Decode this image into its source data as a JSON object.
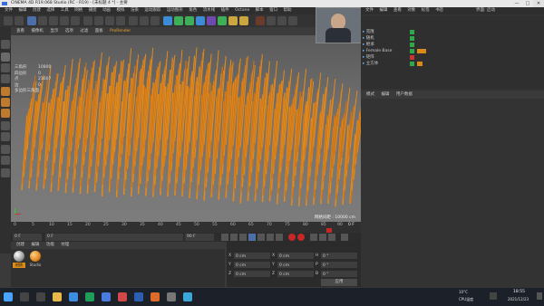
{
  "title_bar": {
    "title": "CINEMA 4D R19.068 Studio (RC - R19) - [未标题 4 *] - 主要",
    "minimize": "—",
    "maximize": "□",
    "close": "✕"
  },
  "main_menu": [
    "文件",
    "编辑",
    "创建",
    "选择",
    "工具",
    "网格",
    "捕捉",
    "动画",
    "模拟",
    "渲染",
    "运动跟踪",
    "运动图形",
    "角色",
    "流水线",
    "插件",
    "Octane",
    "脚本",
    "窗口",
    "帮助"
  ],
  "viewport_menu": [
    "查看",
    "摄像机",
    "显示",
    "选项",
    "过滤",
    "面板",
    "ProRender"
  ],
  "viewport_stats": [
    {
      "label": "三角形",
      "value": "10800"
    },
    {
      "label": "四边形",
      "value": "0"
    },
    {
      "label": "点",
      "value": "21607"
    },
    {
      "label": "边",
      "value": "0"
    },
    {
      "label": "多边形三角面",
      "value": ""
    }
  ],
  "grid_info": "网格间距 : 10000 cm",
  "timeline_ticks": [
    "0",
    "5",
    "10",
    "15",
    "20",
    "25",
    "30",
    "35",
    "40",
    "45",
    "50",
    "55",
    "60",
    "65",
    "70",
    "75",
    "80",
    "85",
    "90"
  ],
  "timeline_end": "0 F",
  "transport": {
    "start_frame": "0 F",
    "current_frame": "0 F",
    "end_frame": "90 F"
  },
  "material_menu": [
    "创建",
    "编辑",
    "功能",
    "纹理"
  ],
  "materials": [
    {
      "name": "材质"
    },
    {
      "name": "Studio"
    }
  ],
  "coordinates": {
    "rows": [
      {
        "axis": "X",
        "pos": "0 cm",
        "size": "0 cm",
        "rot_axis": "H",
        "rot": "0 °"
      },
      {
        "axis": "Y",
        "pos": "0 cm",
        "size": "0 cm",
        "rot_axis": "P",
        "rot": "0 °"
      },
      {
        "axis": "Z",
        "pos": "0 cm",
        "size": "0 cm",
        "rot_axis": "B",
        "rot": "0 °"
      }
    ],
    "apply_label": "应用"
  },
  "right_top_menu": [
    "文件",
    "编辑",
    "查看",
    "对象",
    "标签",
    "书签"
  ],
  "layout_label": "界面: 启动",
  "objects": [
    {
      "name": "克隆"
    },
    {
      "name": "随机"
    },
    {
      "name": "继承"
    },
    {
      "name": "Female Base"
    },
    {
      "name": "矩阵"
    },
    {
      "name": "立方体"
    }
  ],
  "attr_menu": [
    "模式",
    "编辑",
    "用户数据"
  ],
  "taskbar": {
    "time": "18:55",
    "date": "2021/12/23",
    "weather": "10°C",
    "cpu": "CPU温度"
  },
  "colors": {
    "accent": "#f0a030",
    "bars": "#e08a1e",
    "dark": "#2f2f2f",
    "viewport": "#6e6e6e"
  }
}
